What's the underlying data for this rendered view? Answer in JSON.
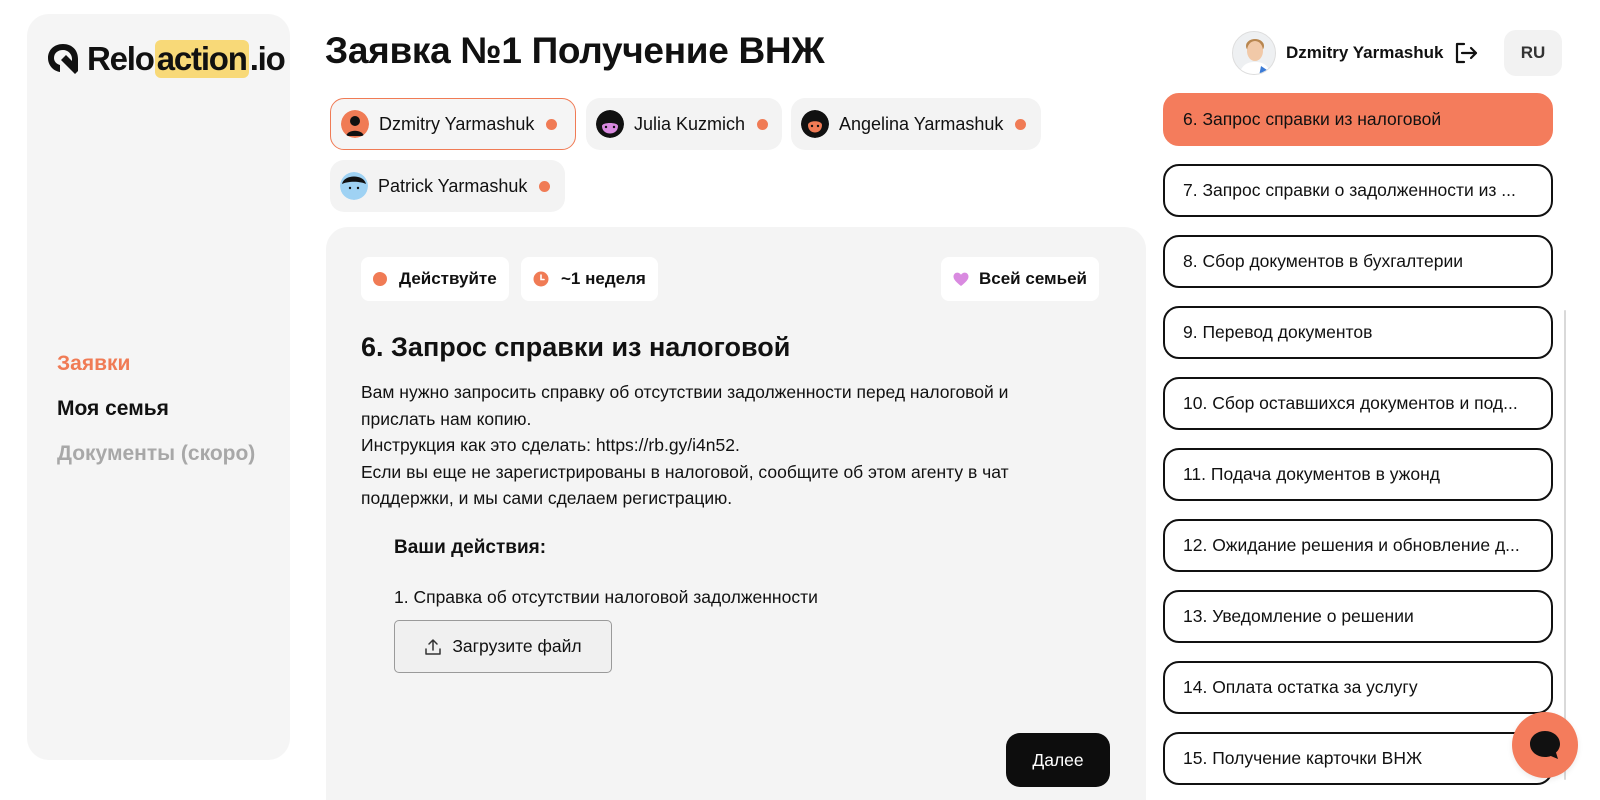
{
  "logo": {
    "part1": "Relo",
    "part2": "action",
    "part3": ".io"
  },
  "nav": {
    "applications": "Заявки",
    "family": "Моя семья",
    "documents": "Документы (скоро)"
  },
  "page_title": "Заявка №1 Получение ВНЖ",
  "user": {
    "name": "Dzmitry Yarmashuk"
  },
  "language": "RU",
  "members": [
    {
      "name": "Dzmitry Yarmashuk"
    },
    {
      "name": "Julia Kuzmich"
    },
    {
      "name": "Angelina Yarmashuk"
    },
    {
      "name": "Patrick Yarmashuk"
    }
  ],
  "card": {
    "status": "Действуйте",
    "duration": "~1 неделя",
    "scope": "Всей семьей",
    "title": "6. Запрос справки из налоговой",
    "desc_line1": "Вам нужно запросить справку об отсутствии задолженности перед налоговой и",
    "desc_line2": "прислать нам копию.",
    "desc_line3": "Инструкция как это сделать: https://rb.gy/i4n52.",
    "desc_line4": "Если вы еще не зарегистрированы в налоговой, сообщите об этом агенту в чат",
    "desc_line5": "поддержки, и мы сами сделаем регистрацию.",
    "actions_title": "Ваши действия:",
    "action_1": "1. Справка об отсутствии налоговой задолженности",
    "upload_label": "Загрузите файл",
    "next_label": "Далее"
  },
  "steps": [
    "6. Запрос справки из налоговой",
    "7. Запрос справки о задолженности из ...",
    "8. Сбор документов в бухгалтерии",
    "9. Перевод документов",
    "10. Сбор оставшихся документов и под...",
    "11. Подача документов в ужонд",
    "12. Ожидание решения и обновление д...",
    "13. Уведомление о решении",
    "14. Оплата остатка за услугу",
    "15. Получение карточки ВНЖ"
  ],
  "colors": {
    "accent": "#f07b55",
    "step_active": "#f47c5c",
    "heart": "#d98ae0",
    "logo_highlight": "#f8d978"
  }
}
